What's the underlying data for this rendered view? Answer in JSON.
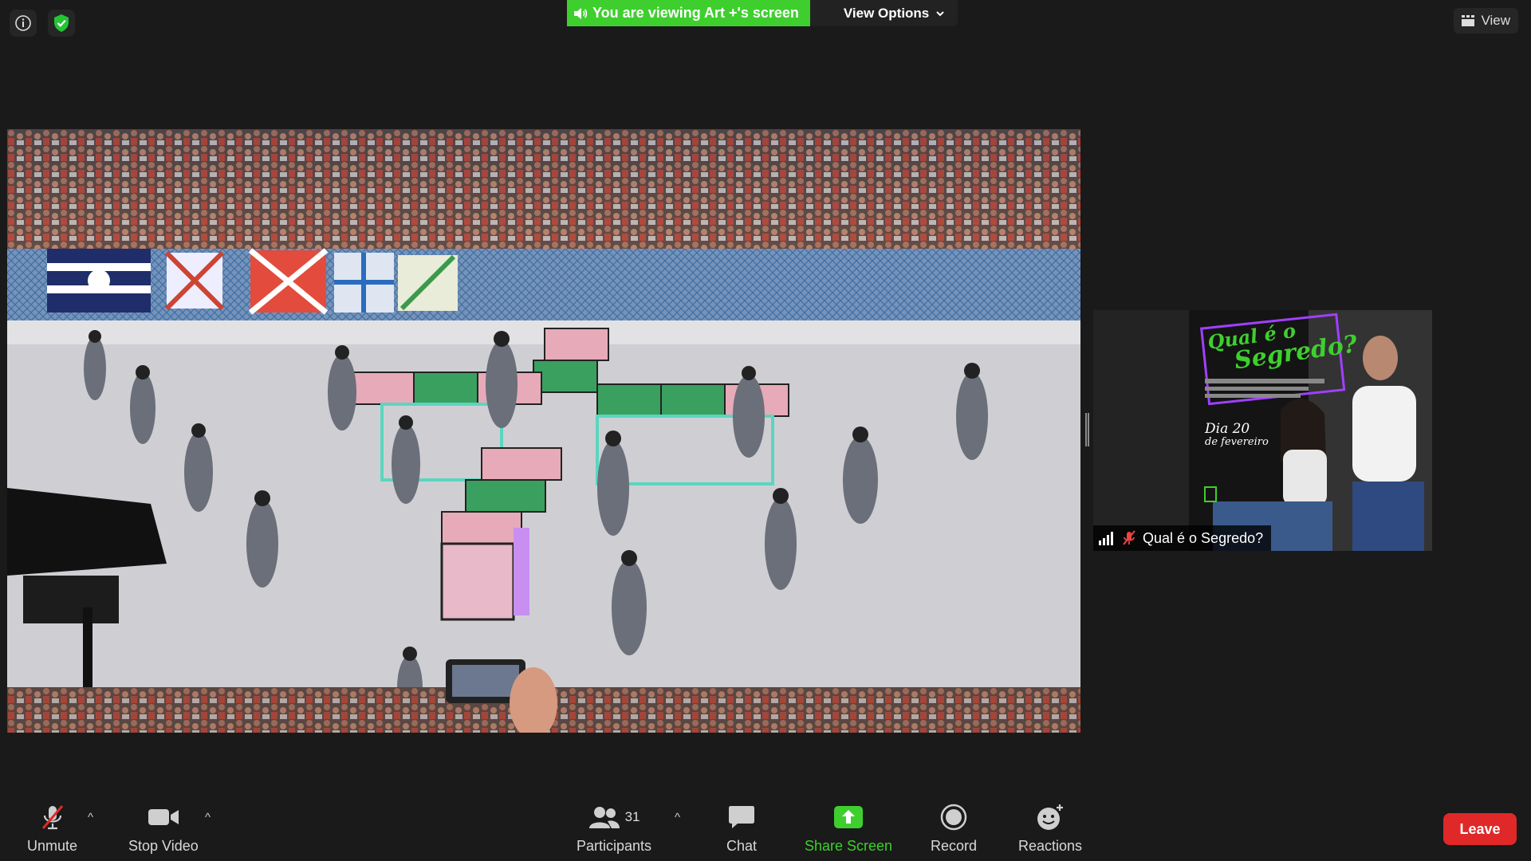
{
  "banner": {
    "viewing_text": "You are viewing Art +'s screen",
    "view_options_label": "View Options"
  },
  "top_right": {
    "view_label": "View"
  },
  "participant_tile": {
    "name": "Qual é o Segredo?",
    "poster_title_line1": "Qual é o",
    "poster_title_line2": "Segredo?",
    "poster_date_line1": "Dia 20",
    "poster_date_line2": "de fevereiro"
  },
  "toolbar": {
    "unmute_label": "Unmute",
    "stop_video_label": "Stop Video",
    "participants_label": "Participants",
    "participants_count": "31",
    "chat_label": "Chat",
    "share_screen_label": "Share Screen",
    "record_label": "Record",
    "reactions_label": "Reactions",
    "leave_label": "Leave"
  },
  "colors": {
    "share_green": "#3ecf2e",
    "leave_red": "#e02828",
    "background": "#1a1a1a"
  },
  "icons": [
    "info-icon",
    "shield-check-icon",
    "grid-icon",
    "chevron-down-icon",
    "speaker-icon",
    "mic-muted-icon",
    "video-camera-icon",
    "participants-icon",
    "chat-bubble-icon",
    "share-screen-icon",
    "record-icon",
    "reactions-icon",
    "signal-icon"
  ]
}
